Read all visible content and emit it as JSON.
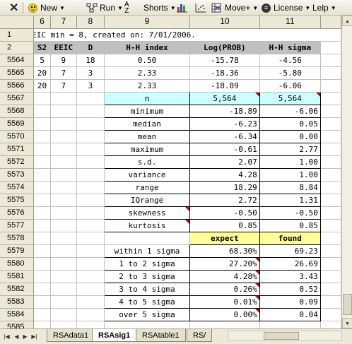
{
  "toolbar": {
    "new_label": "New",
    "run_label": "Run",
    "shorts_label": "Shorts",
    "move_label": "Move+",
    "license_label": "License",
    "help_label": "Lelp"
  },
  "columns": [
    "6",
    "7",
    "8",
    "9",
    "10",
    "11"
  ],
  "rows": {
    "r1": {
      "num": "1",
      "text": "EIC min = 8, created on: 7/01/2006."
    },
    "r2": {
      "num": "2",
      "cells": [
        "S2",
        "EEIC",
        "D",
        "H-H index",
        "Log(PROB)",
        "H-H sigma"
      ]
    },
    "data": [
      {
        "num": "5564",
        "cells": [
          "5",
          "9",
          "18",
          "0.50",
          "-15.78",
          "-4.56"
        ]
      },
      {
        "num": "5565",
        "cells": [
          "20",
          "7",
          "3",
          "2.33",
          "-18.36",
          "-5.80"
        ]
      },
      {
        "num": "5566",
        "cells": [
          "20",
          "7",
          "3",
          "2.33",
          "-18.89",
          "-6.06"
        ]
      }
    ],
    "stats": [
      {
        "num": "5567",
        "label": "n",
        "v1": "5,564",
        "v2": "5,564"
      },
      {
        "num": "5568",
        "label": "minimum",
        "v1": "-18.89",
        "v2": "-6.06"
      },
      {
        "num": "5569",
        "label": "median",
        "v1": "-6.23",
        "v2": "0.05"
      },
      {
        "num": "5570",
        "label": "mean",
        "v1": "-6.34",
        "v2": "0.00"
      },
      {
        "num": "5571",
        "label": "maximum",
        "v1": "-0.61",
        "v2": "2.77"
      },
      {
        "num": "5572",
        "label": "s.d.",
        "v1": "2.07",
        "v2": "1.00"
      },
      {
        "num": "5573",
        "label": "variance",
        "v1": "4.28",
        "v2": "1.00"
      },
      {
        "num": "5574",
        "label": "range",
        "v1": "18.29",
        "v2": "8.84"
      },
      {
        "num": "5575",
        "label": "IQrange",
        "v1": "2.72",
        "v2": "1.31"
      },
      {
        "num": "5576",
        "label": "skewness",
        "v1": "-0.50",
        "v2": "-0.50"
      },
      {
        "num": "5577",
        "label": "kurtosis",
        "v1": "0.85",
        "v2": "0.85"
      }
    ],
    "header_row": {
      "num": "5578",
      "expect": "expect",
      "found": "found"
    },
    "sigma": [
      {
        "num": "5579",
        "label": "within 1 sigma",
        "expect": "68.30%",
        "found": "69.23"
      },
      {
        "num": "5580",
        "label": "1 to 2 sigma",
        "expect": "27.20%",
        "found": "26.69"
      },
      {
        "num": "5581",
        "label": "2 to 3 sigma",
        "expect": "4.28%",
        "found": "3.43"
      },
      {
        "num": "5582",
        "label": "3 to 4 sigma",
        "expect": "0.26%",
        "found": "0.52"
      },
      {
        "num": "5583",
        "label": "4 to 5 sigma",
        "expect": "0.01%",
        "found": "0.09"
      },
      {
        "num": "5584",
        "label": "over 5 sigma",
        "expect": "0.00%",
        "found": "0.04"
      }
    ],
    "last": {
      "num": "5585"
    }
  },
  "tabs": [
    "RSAdata1",
    "RSAsig1",
    "RSAtable1",
    "RS/"
  ],
  "active_tab": "RSAsig1"
}
